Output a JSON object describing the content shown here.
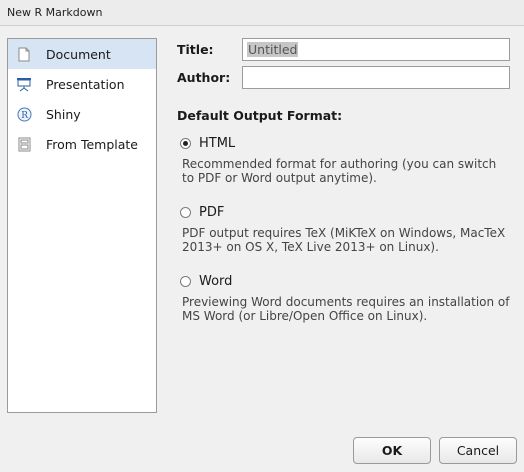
{
  "window": {
    "title": "New R Markdown"
  },
  "sidebar": {
    "items": [
      {
        "label": "Document",
        "icon": "document-icon",
        "selected": true
      },
      {
        "label": "Presentation",
        "icon": "presentation-icon",
        "selected": false
      },
      {
        "label": "Shiny",
        "icon": "shiny-icon",
        "selected": false
      },
      {
        "label": "From Template",
        "icon": "template-icon",
        "selected": false
      }
    ]
  },
  "form": {
    "title_label": "Title:",
    "title_value": "Untitled",
    "author_label": "Author:",
    "author_value": ""
  },
  "output": {
    "heading": "Default Output Format:",
    "options": [
      {
        "label": "HTML",
        "checked": true,
        "description": "Recommended format for authoring (you can switch to PDF or Word output anytime)."
      },
      {
        "label": "PDF",
        "checked": false,
        "description": "PDF output requires TeX (MiKTeX on Windows, MacTeX 2013+ on OS X, TeX Live 2013+ on Linux)."
      },
      {
        "label": "Word",
        "checked": false,
        "description": "Previewing Word documents requires an installation of MS Word (or Libre/Open Office on Linux)."
      }
    ]
  },
  "buttons": {
    "ok": "OK",
    "cancel": "Cancel"
  },
  "colors": {
    "selection": "#d6e4f3",
    "background": "#f0f0f0"
  }
}
